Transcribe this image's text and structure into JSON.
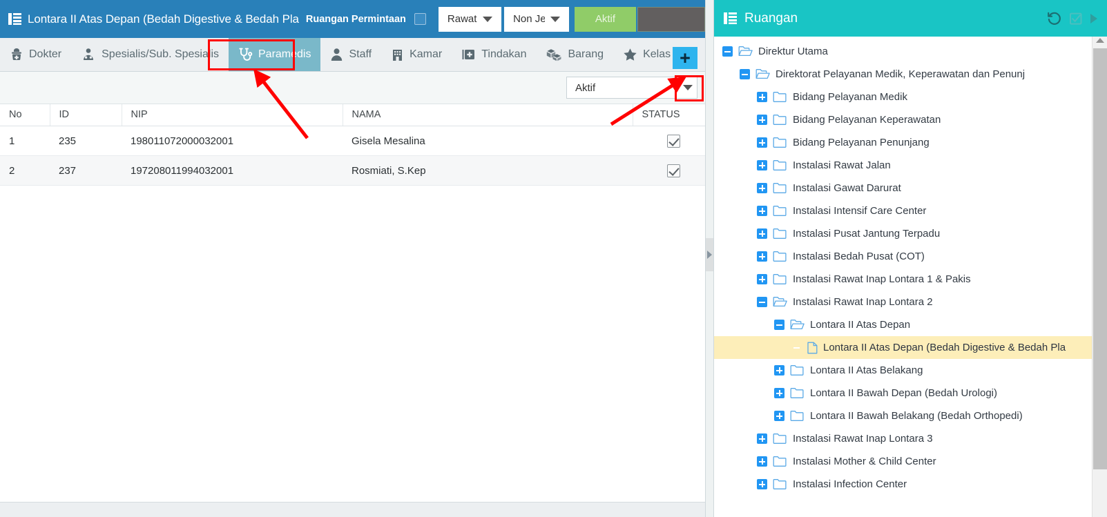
{
  "left": {
    "titlebar": {
      "menu_icon": "list-icon",
      "title": "Lontara II Atas Depan (Bedah Digestive & Bedah Pla",
      "subtitle": "Ruangan Permintaan",
      "checkbox_name": "ruangan-permintaan-checkbox",
      "select_rawat": "Rawat",
      "select_jenis": "Non Je",
      "button_aktif": "Aktif",
      "button_blank": "",
      "bg_color": "#2980b9",
      "aktif_color": "#90cc68"
    },
    "tabs": [
      {
        "label": "Dokter",
        "icon": "doctor-icon",
        "active": false
      },
      {
        "label": "Spesialis/Sub. Spesialis",
        "icon": "specialist-icon",
        "active": false
      },
      {
        "label": "Paramedis",
        "icon": "stethoscope-icon",
        "active": true
      },
      {
        "label": "Staff",
        "icon": "person-icon",
        "active": false
      },
      {
        "label": "Kamar",
        "icon": "building-icon",
        "active": false
      },
      {
        "label": "Tindakan",
        "icon": "medkit-icon",
        "active": false
      },
      {
        "label": "Barang",
        "icon": "boxes-icon",
        "active": false
      },
      {
        "label": "Kelas",
        "icon": "star-icon",
        "active": false
      }
    ],
    "toolbar": {
      "add_label": "+",
      "add_color": "#2eb4ee",
      "status_filter": "Aktif"
    },
    "table": {
      "columns": [
        "No",
        "ID",
        "NIP",
        "NAMA",
        "STATUS"
      ],
      "rows": [
        {
          "no": "1",
          "id": "235",
          "nip": "198011072000032001",
          "nama": "Gisela Mesalina",
          "status": "checked"
        },
        {
          "no": "2",
          "id": "237",
          "nip": "197208011994032001",
          "nama": "Rosmiati, S.Kep",
          "status": "checked"
        }
      ]
    }
  },
  "right": {
    "header": {
      "icon": "list-icon",
      "title": "Ruangan",
      "bg_color": "#19c5c5",
      "actions": [
        {
          "name": "history-icon"
        },
        {
          "name": "checkbox-icon"
        },
        {
          "name": "play-arrow-icon"
        }
      ]
    },
    "tree": [
      {
        "label": "Direktur Utama",
        "depth": 0,
        "toggle": "minus",
        "icon": "folder-open-icon",
        "selected": false
      },
      {
        "label": "Direktorat Pelayanan Medik, Keperawatan dan Penunj",
        "depth": 1,
        "toggle": "minus",
        "icon": "folder-open-icon",
        "selected": false
      },
      {
        "label": "Bidang Pelayanan Medik",
        "depth": 2,
        "toggle": "plus",
        "icon": "folder-icon",
        "selected": false
      },
      {
        "label": "Bidang Pelayanan Keperawatan",
        "depth": 2,
        "toggle": "plus",
        "icon": "folder-icon",
        "selected": false
      },
      {
        "label": "Bidang Pelayanan Penunjang",
        "depth": 2,
        "toggle": "plus",
        "icon": "folder-icon",
        "selected": false
      },
      {
        "label": "Instalasi Rawat Jalan",
        "depth": 2,
        "toggle": "plus",
        "icon": "folder-icon",
        "selected": false
      },
      {
        "label": "Instalasi Gawat Darurat",
        "depth": 2,
        "toggle": "plus",
        "icon": "folder-icon",
        "selected": false
      },
      {
        "label": "Instalasi Intensif Care Center",
        "depth": 2,
        "toggle": "plus",
        "icon": "folder-icon",
        "selected": false
      },
      {
        "label": "Instalasi Pusat Jantung Terpadu",
        "depth": 2,
        "toggle": "plus",
        "icon": "folder-icon",
        "selected": false
      },
      {
        "label": "Instalasi Bedah Pusat (COT)",
        "depth": 2,
        "toggle": "plus",
        "icon": "folder-icon",
        "selected": false
      },
      {
        "label": "Instalasi Rawat Inap Lontara 1 & Pakis",
        "depth": 2,
        "toggle": "plus",
        "icon": "folder-icon",
        "selected": false
      },
      {
        "label": "Instalasi Rawat Inap Lontara 2",
        "depth": 2,
        "toggle": "minus",
        "icon": "folder-open-icon",
        "selected": false
      },
      {
        "label": "Lontara II Atas Depan",
        "depth": 3,
        "toggle": "minus",
        "icon": "folder-open-icon",
        "selected": false
      },
      {
        "label": "Lontara II Atas Depan (Bedah Digestive & Bedah Pla",
        "depth": 4,
        "toggle": "none",
        "icon": "document-icon",
        "selected": true
      },
      {
        "label": "Lontara II Atas Belakang",
        "depth": 3,
        "toggle": "plus",
        "icon": "folder-icon",
        "selected": false
      },
      {
        "label": "Lontara II Bawah Depan (Bedah Urologi)",
        "depth": 3,
        "toggle": "plus",
        "icon": "folder-icon",
        "selected": false
      },
      {
        "label": "Lontara II Bawah Belakang (Bedah Orthopedi)",
        "depth": 3,
        "toggle": "plus",
        "icon": "folder-icon",
        "selected": false
      },
      {
        "label": "Instalasi Rawat Inap Lontara 3",
        "depth": 2,
        "toggle": "plus",
        "icon": "folder-icon",
        "selected": false
      },
      {
        "label": "Instalasi Mother & Child Center",
        "depth": 2,
        "toggle": "plus",
        "icon": "folder-icon",
        "selected": false
      },
      {
        "label": "Instalasi Infection Center",
        "depth": 2,
        "toggle": "plus",
        "icon": "folder-icon",
        "selected": false
      }
    ]
  },
  "annotations": {
    "highlight_color": "#ff0000",
    "boxes": [
      "paramedis-tab",
      "add-button"
    ],
    "arrows": [
      "arrow-to-paramedis-tab",
      "arrow-to-add-button"
    ]
  }
}
